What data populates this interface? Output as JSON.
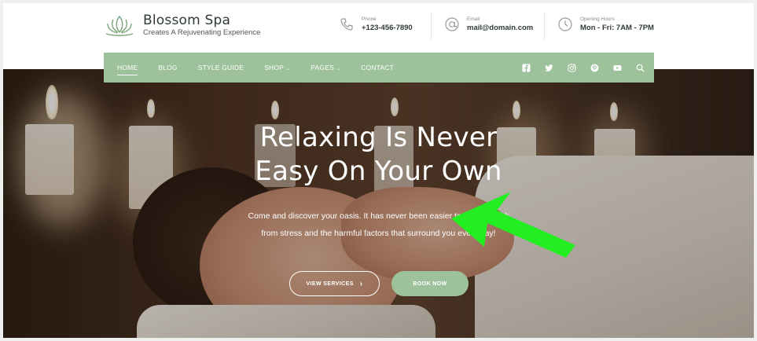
{
  "brand": {
    "name": "Blossom Spa",
    "tagline": "Creates A Rejuvenating Experience"
  },
  "contact": [
    {
      "label": "Phone",
      "value": "+123-456-7890",
      "icon": "phone-icon"
    },
    {
      "label": "Email",
      "value": "mail@domain.com",
      "icon": "at-icon"
    },
    {
      "label": "Opening Hours",
      "value": "Mon - Fri: 7AM - 7PM",
      "icon": "clock-icon"
    }
  ],
  "nav": {
    "items": [
      {
        "label": "HOME"
      },
      {
        "label": "BLOG"
      },
      {
        "label": "STYLE GUIDE"
      },
      {
        "label": "SHOP"
      },
      {
        "label": "PAGES"
      },
      {
        "label": "CONTACT"
      }
    ],
    "socials": [
      "facebook-icon",
      "twitter-icon",
      "instagram-icon",
      "pinterest-icon",
      "youtube-icon",
      "search-icon"
    ]
  },
  "hero": {
    "title_line1": "Relaxing Is Never",
    "title_line2": "Easy On Your Own",
    "subtitle": "Come and discover your oasis. It has never been easier to take a break from stress and the harmful factors that surround you every day!",
    "view_services": "VIEW SERVICES",
    "book_now": "BOOK NOW"
  },
  "colors": {
    "accent": "#9dc19b",
    "pointer": "#22ee22",
    "text_dark": "#2f3a34"
  }
}
